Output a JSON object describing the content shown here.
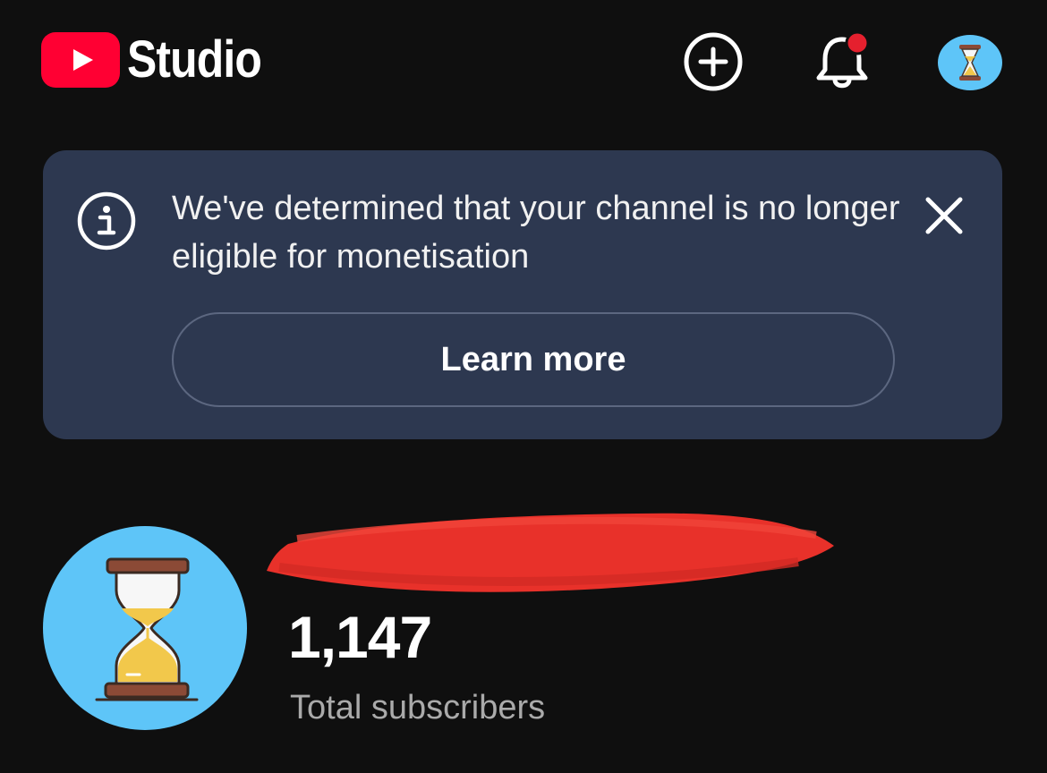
{
  "header": {
    "brand_text": "Studio",
    "logo_color": "#ff0033",
    "icons": [
      "youtube-logo-icon",
      "create-plus-icon",
      "notifications-bell-icon",
      "account-avatar-hourglass-icon"
    ],
    "notification_dot_color": "#e5202e"
  },
  "banner": {
    "message": "We've determined that your channel is no longer eligible for monetisation",
    "action_label": "Learn more",
    "background": "#2d3850",
    "icons": [
      "info-icon",
      "close-icon"
    ]
  },
  "channel": {
    "name": "",
    "name_redacted": true,
    "subscriber_count": "1,147",
    "subscriber_label": "Total subscribers",
    "avatar_background": "#5ec5f8",
    "avatar_icon": "hourglass-icon"
  }
}
